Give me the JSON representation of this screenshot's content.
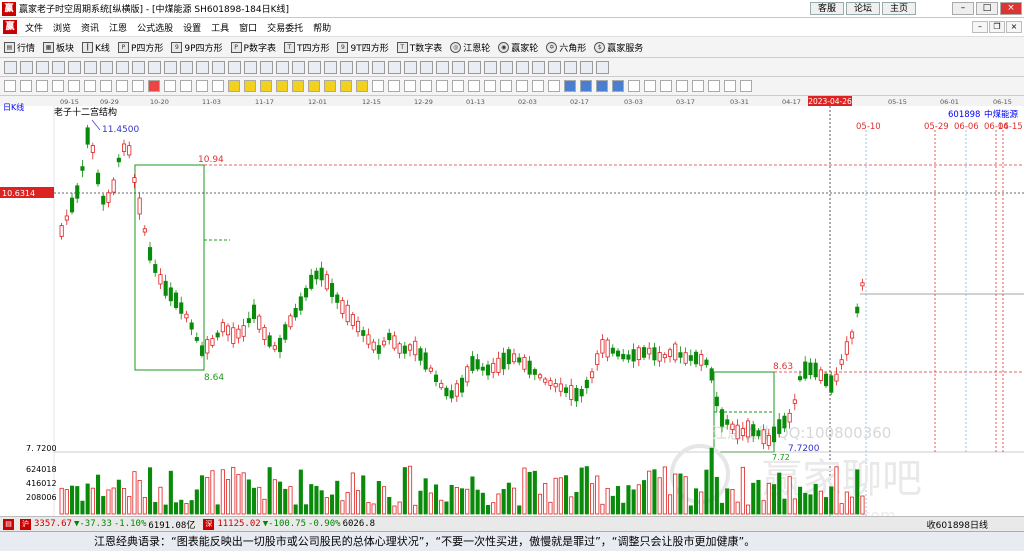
{
  "titlebar": {
    "title": "赢家老子时空周期系统[纵横版] - [中煤能源  SH601898-184日K线]",
    "links": [
      "客服",
      "论坛",
      "主页"
    ]
  },
  "menu": {
    "items": [
      "文件",
      "浏览",
      "资讯",
      "江恩",
      "公式选股",
      "设置",
      "工具",
      "窗口",
      "交易委托",
      "帮助"
    ]
  },
  "toolbar": {
    "items": [
      {
        "label": "行情",
        "icon": "quotes-icon"
      },
      {
        "label": "板块",
        "icon": "sector-icon"
      },
      {
        "label": "K线",
        "icon": "kline-icon"
      },
      {
        "label": "P四方形",
        "icon": "p-square-icon"
      },
      {
        "label": "9P四方形",
        "icon": "9p-square-icon"
      },
      {
        "label": "P数字表",
        "icon": "p-number-table-icon"
      },
      {
        "label": "T四方形",
        "icon": "t-square-icon"
      },
      {
        "label": "9T四方形",
        "icon": "9t-square-icon"
      },
      {
        "label": "T数字表",
        "icon": "t-number-table-icon"
      },
      {
        "label": "江恩轮",
        "icon": "gann-wheel-icon"
      },
      {
        "label": "赢家轮",
        "icon": "winner-wheel-icon"
      },
      {
        "label": "六角形",
        "icon": "hexagon-icon"
      },
      {
        "label": "赢家服务",
        "icon": "service-icon"
      }
    ]
  },
  "chart": {
    "period_label": "日K线",
    "structure_label": "老子十二宫结构",
    "high_label": "11.4500",
    "level_high": "10.94",
    "level_low": "8.64",
    "level_mid": "8.63",
    "low_label": "7.7200",
    "low_label2": "7.72",
    "price_tag": "10.6314",
    "price_axis_bottom": "7. 7200",
    "vol_labels": [
      "624018",
      "416012",
      "208006"
    ],
    "code": "601898",
    "name": "中煤能源",
    "selected_date": "2023-04-26",
    "date_ticks": [
      "09-15",
      "09-29",
      "10-20",
      "11-03",
      "11-17",
      "12-01",
      "12-15",
      "12-29",
      "01-13",
      "02-03",
      "02-17",
      "03-03",
      "03-17",
      "03-31",
      "04-17",
      "05-15",
      "06-01",
      "06-15"
    ],
    "future_dates": [
      "05-10",
      "05-29",
      "06-06",
      "06-14",
      "06-15"
    ],
    "watermark": "江恩软件  QQ:100800360",
    "watermark2": "赢家聊吧",
    "watermark3": "liaoba.yjgs360.com",
    "colors": {
      "up": "#e02020",
      "down": "#0a8a0a",
      "accent": "#e03030"
    }
  },
  "status": {
    "idx1_value": "3357.67",
    "idx1_change": "▼-37.33",
    "idx1_pct": "-1.10%",
    "idx1_amount": "6191.08亿",
    "idx2_value": "11125.02",
    "idx2_change": "▼-100.75",
    "idx2_pct": "-0.90%",
    "idx2_amount": "6026.8",
    "right_text": "收601898日线"
  },
  "quote": {
    "text": "江恩经典语录：“图表能反映出一切股市或公司股民的总体心理状况”，“不要一次性买进，傲慢就是罪过”，“调整只会让股市更加健康”。"
  }
}
